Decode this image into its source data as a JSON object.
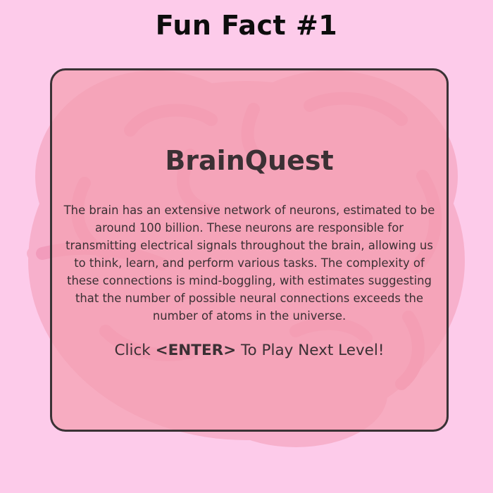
{
  "page": {
    "title": "Fun Fact #1"
  },
  "card": {
    "title": "BrainQuest",
    "fact": "The brain has an extensive network of neurons, estimated to be around 100 billion. These neurons are responsible for transmitting electrical signals throughout the brain, allowing us to think, learn, and perform various tasks. The complexity of these connections is mind-boggling, with estimates suggesting that the number of possible neural connections exceeds the number of atoms in the universe.",
    "prompt_before": "Click ",
    "prompt_key": "<ENTER>",
    "prompt_after": " To Play Next Level!"
  },
  "colors": {
    "background": "#fdcbea",
    "brain": "#f7b0cc",
    "card_fill": "#f4a0b2",
    "card_border": "#3a3235",
    "text": "#3b3034"
  },
  "icons": {
    "background_art": "brain-illustration"
  }
}
